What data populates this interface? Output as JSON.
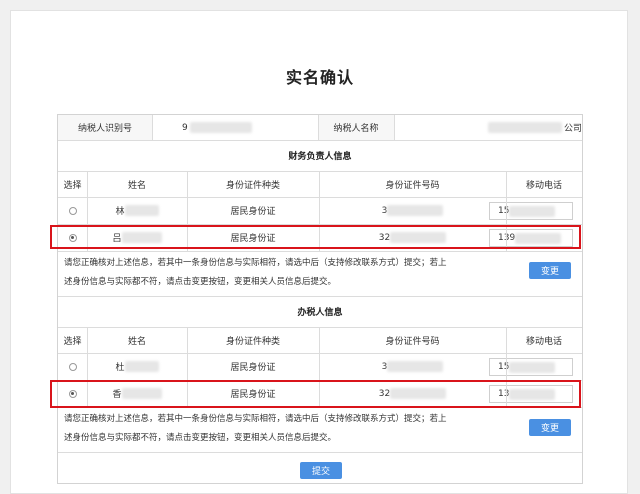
{
  "page": {
    "title": "实名确认"
  },
  "taxpayer": {
    "id_label": "纳税人识别号",
    "id_value": "9",
    "name_label": "纳税人名称",
    "name_value": "公司"
  },
  "finance": {
    "section_title": "财务负责人信息",
    "headers": [
      "选择",
      "姓名",
      "身份证件种类",
      "身份证件号码",
      "移动电话"
    ],
    "rows": [
      {
        "selected": false,
        "name": "林",
        "id_type": "居民身份证",
        "id_number": "3",
        "phone": "15"
      },
      {
        "selected": true,
        "name": "吕",
        "id_type": "居民身份证",
        "id_number": "32",
        "phone": "139"
      }
    ],
    "note_line1": "请您正确核对上述信息，若其中一条身份信息与实际相符，请选中后（支持修改联系方式）提交；若上",
    "note_line2": "述身份信息与实际都不符，请点击变更按钮，变更相关人员信息后提交。",
    "change_button": "变更"
  },
  "tax_agent": {
    "section_title": "办税人信息",
    "headers": [
      "选择",
      "姓名",
      "身份证件种类",
      "身份证件号码",
      "移动电话"
    ],
    "rows": [
      {
        "selected": false,
        "name": "杜",
        "id_type": "居民身份证",
        "id_number": "3",
        "phone": "15"
      },
      {
        "selected": true,
        "name": "香",
        "id_type": "居民身份证",
        "id_number": "32",
        "phone": "13"
      }
    ],
    "note_line1": "请您正确核对上述信息，若其中一条身份信息与实际相符，请选中后（支持修改联系方式）提交；若上",
    "note_line2": "述身份信息与实际都不符，请点击变更按钮，变更相关人员信息后提交。",
    "change_button": "变更"
  },
  "submit_button": "提交",
  "colors": {
    "accent": "#4a90e2",
    "highlight": "#d9141b",
    "header_bg": "#f7f7f7"
  }
}
